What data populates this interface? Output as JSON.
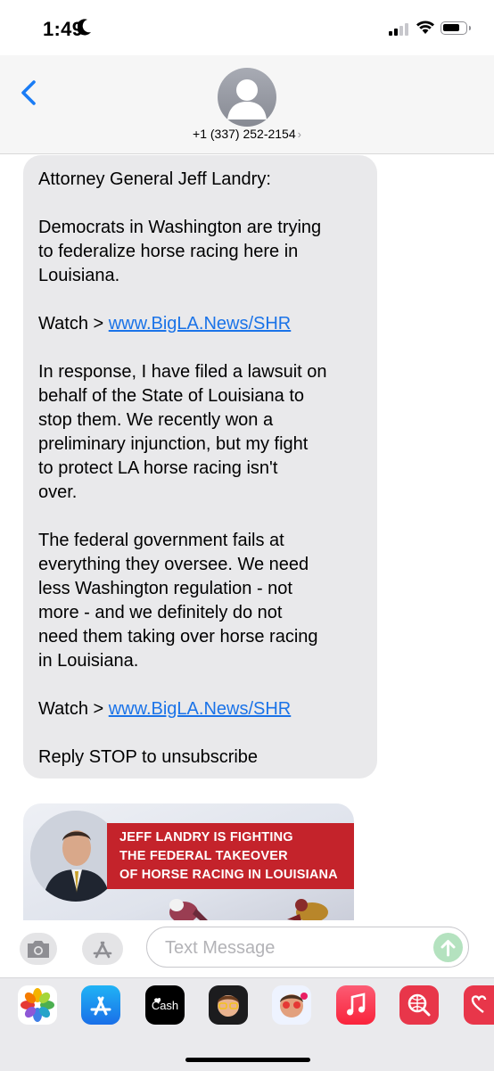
{
  "status_bar": {
    "time": "1:49"
  },
  "header": {
    "contact": "+1 (337) 252-2154",
    "chevron": "›"
  },
  "message": {
    "line_intro": "Attorney General Jeff Landry:",
    "para1": "Democrats in Washington are trying\nto federalize horse racing here in\nLouisiana.",
    "watch_prefix": "Watch > ",
    "watch_link": "www.BigLA.News/SHR",
    "para2": "In response, I have filed a lawsuit on\nbehalf of the State of Louisiana to\nstop them. We recently won a\npreliminary injunction, but my fight\nto protect LA horse racing isn't\nover.",
    "para3": "The federal government fails at\neverything they oversee. We need\nless Washington regulation - not\nmore - and we definitely do not\nneed them taking over horse racing\nin Louisiana.",
    "watch_prefix_2": "Watch > ",
    "watch_link_2": "www.BigLA.News/SHR",
    "unsubscribe": "Reply STOP to unsubscribe"
  },
  "image_banner": {
    "line1": "JEFF LANDRY IS FIGHTING",
    "line2": "THE FEDERAL TAKEOVER",
    "line3": "OF HORSE RACING IN LOUISIANA"
  },
  "compose": {
    "placeholder": "Text Message"
  },
  "app_drawer": {
    "apps": [
      "photos-icon",
      "app-store-icon",
      "apple-cash-icon",
      "memoji-icon",
      "memoji-stickers-icon",
      "music-icon",
      "web-search-icon",
      "digital-touch-icon"
    ],
    "cash_label": "Cash",
    "colors": {
      "send": "#b4e2bf",
      "link": "#1a73e8",
      "bubble": "#e9e9eb",
      "banner": "#c4232b"
    }
  }
}
